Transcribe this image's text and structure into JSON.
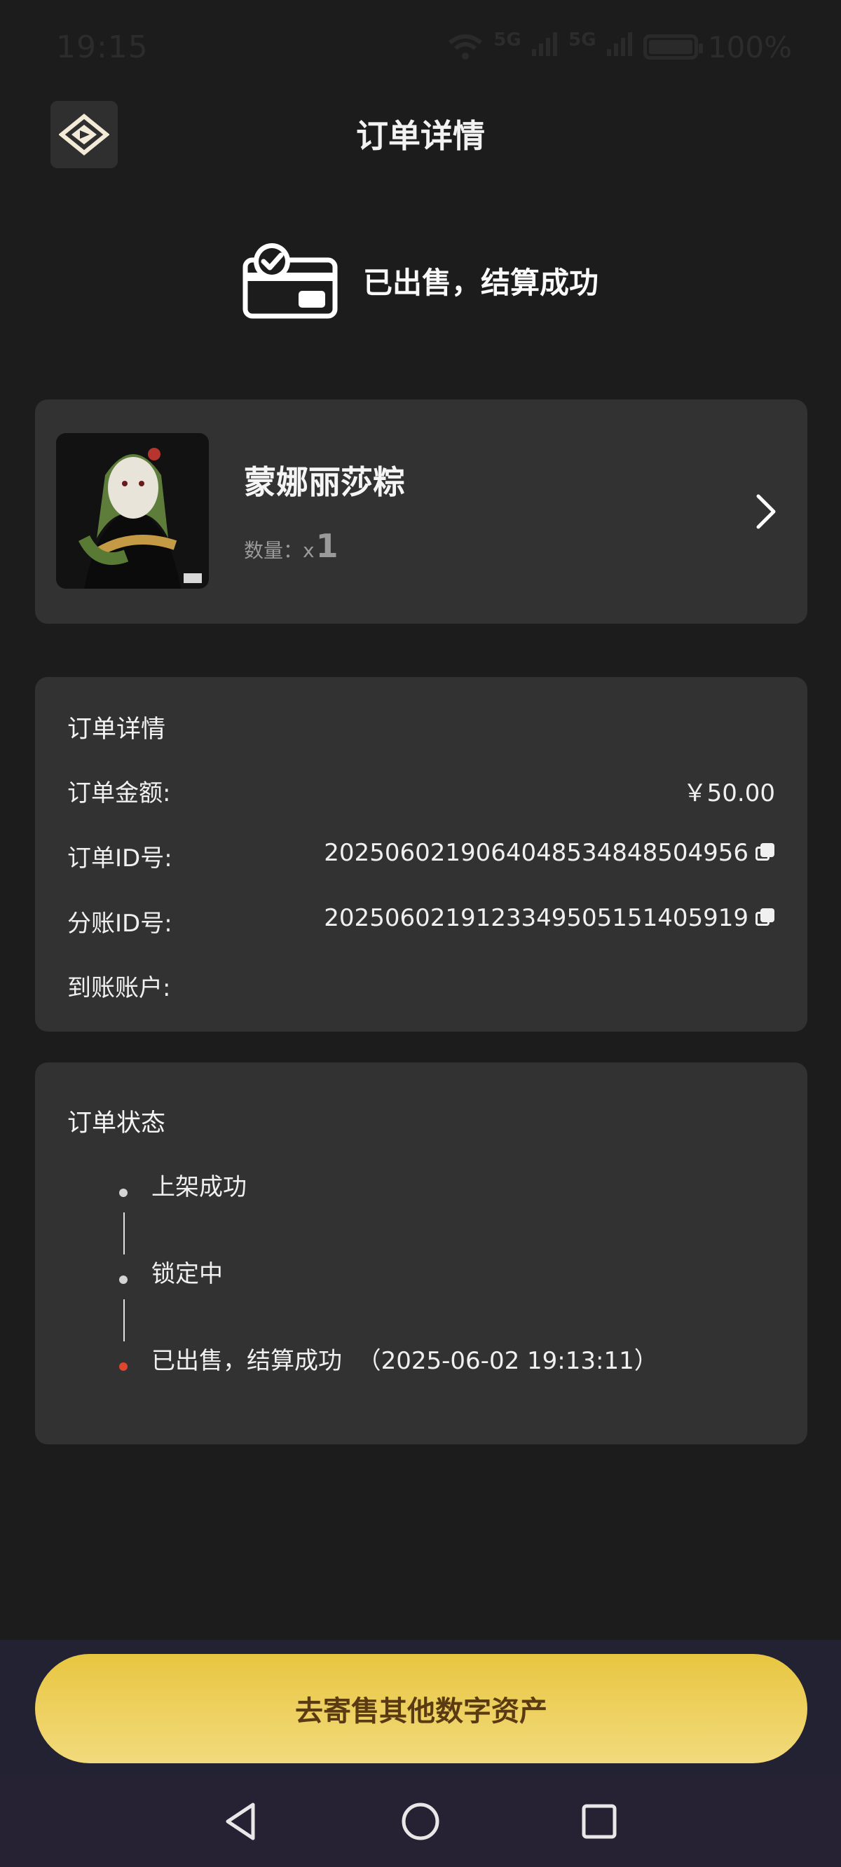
{
  "status_bar": {
    "time": "19:15",
    "net1": "5G",
    "net2": "5G",
    "battery": "100%"
  },
  "header": {
    "title": "订单详情"
  },
  "hero": {
    "status_text": "已出售，结算成功"
  },
  "product": {
    "name": "蒙娜丽莎粽",
    "qty_label": "数量：x",
    "qty_value": "1"
  },
  "order_detail": {
    "title": "订单详情",
    "rows": [
      {
        "label": "订单金额:",
        "value": "￥50.00"
      },
      {
        "label": "订单ID号:",
        "value": "2025060219064048534848504956"
      },
      {
        "label": "分账ID号:",
        "value": "2025060219123349505151405919"
      },
      {
        "label": "到账账户:",
        "value": ""
      }
    ]
  },
  "order_state": {
    "title": "订单状态",
    "steps": [
      {
        "text": "上架成功",
        "color": "#d4d4d4"
      },
      {
        "text": "锁定中",
        "color": "#d4d4d4"
      },
      {
        "text": "已出售，结算成功  （2025-06-02 19:13:11）",
        "color": "#e0452f"
      }
    ]
  },
  "cta": {
    "label": "去寄售其他数字资产"
  },
  "colors": {
    "background": "#1c1c1c",
    "card": "#323232",
    "accent": "#e8c641",
    "cta_text": "#5a3a12",
    "active_dot": "#e0452f"
  }
}
